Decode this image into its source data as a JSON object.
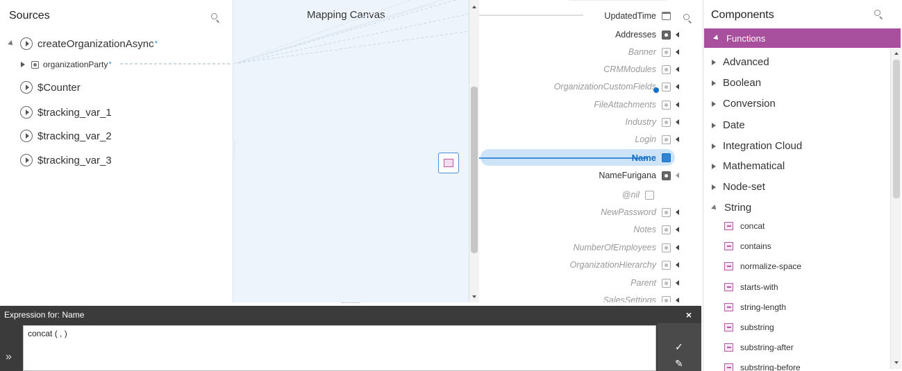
{
  "sources": {
    "title": "Sources",
    "items": [
      {
        "label": "createOrganizationAsync",
        "star": "*",
        "expanded": true
      },
      {
        "label": "organizationParty",
        "star": "*",
        "child": true
      },
      {
        "label": "$Counter"
      },
      {
        "label": "$tracking_var_1"
      },
      {
        "label": "$tracking_var_2"
      },
      {
        "label": "$tracking_var_3"
      }
    ]
  },
  "canvas": {
    "title": "Mapping Canvas"
  },
  "target": {
    "items": [
      {
        "label": "UpdatedTime"
      },
      {
        "label": "Addresses"
      },
      {
        "label": "Banner"
      },
      {
        "label": "CRMModules"
      },
      {
        "label": "OrganizationCustomFields"
      },
      {
        "label": "FileAttachments"
      },
      {
        "label": "Industry"
      },
      {
        "label": "Login"
      },
      {
        "label": "Name"
      },
      {
        "label": "NameFurigana"
      },
      {
        "label": "@nil"
      },
      {
        "label": "NewPassword"
      },
      {
        "label": "Notes"
      },
      {
        "label": "NumberOfEmployees"
      },
      {
        "label": "OrganizationHierarchy"
      },
      {
        "label": "Parent"
      },
      {
        "label": "SalesSettings"
      }
    ]
  },
  "components": {
    "title": "Components",
    "functions_label": "Functions",
    "categories": [
      "Advanced",
      "Boolean",
      "Conversion",
      "Date",
      "Integration Cloud",
      "Mathematical",
      "Node-set",
      "String"
    ],
    "string_functions": [
      "concat",
      "contains",
      "normalize-space",
      "starts-with",
      "string-length",
      "substring",
      "substring-after",
      "substring-before"
    ]
  },
  "expression": {
    "header_prefix": "Expression for:",
    "target_name": "Name",
    "close": "×",
    "text": "concat ( , )",
    "expand": "»",
    "check": "✓",
    "pen": "✎"
  },
  "colors": {
    "accent": "#1570c9",
    "functions_bar": "#a84f9d",
    "expr_bg": "#3b3b3b",
    "highlight": "#cde3f7"
  },
  "icons": {
    "search": "search-icon",
    "node": "node-expand-icon",
    "function": "function-icon"
  }
}
